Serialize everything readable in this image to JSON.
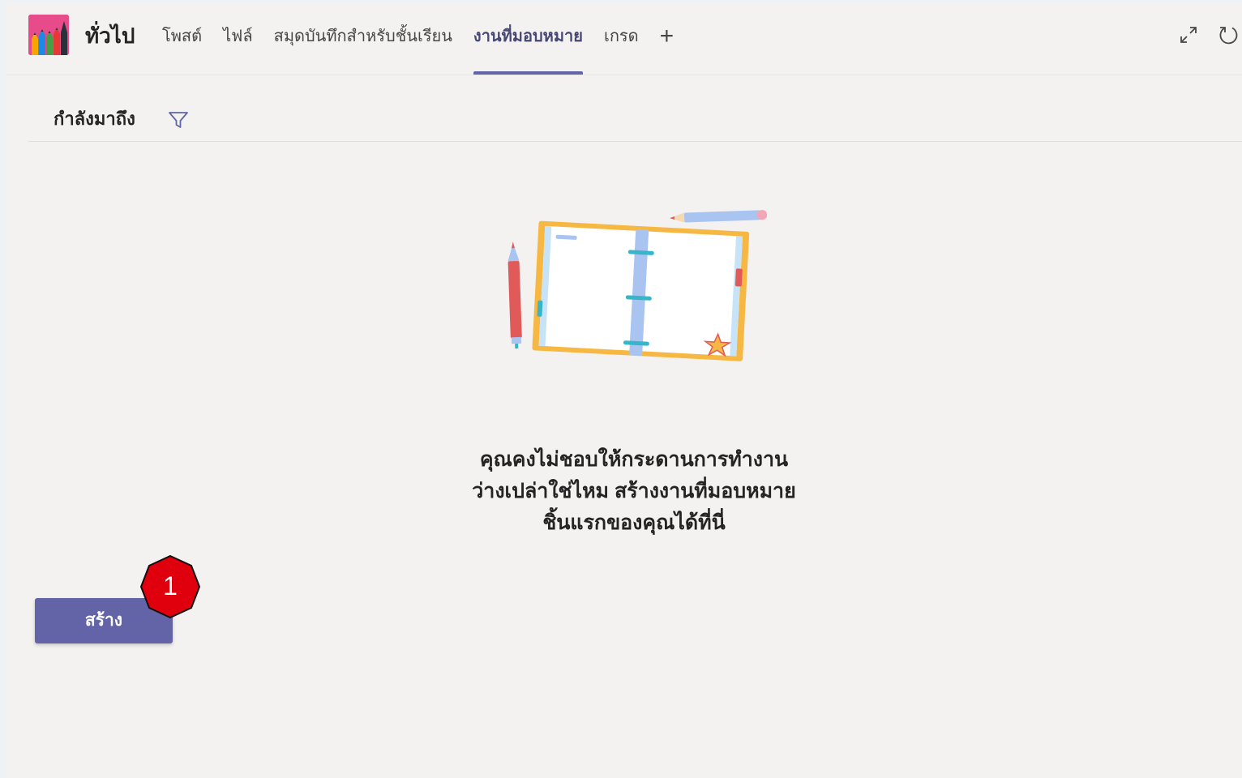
{
  "header": {
    "channel_name": "ทั่วไป",
    "tabs": [
      {
        "label": "โพสต์",
        "active": false
      },
      {
        "label": "ไฟล์",
        "active": false
      },
      {
        "label": "สมุดบันทึกสำหรับชั้นเรียน",
        "active": false
      },
      {
        "label": "งานที่มอบหมาย",
        "active": true
      },
      {
        "label": "เกรด",
        "active": false
      }
    ],
    "add_tab_label": "+",
    "icons": [
      "team-avatar",
      "expand-icon",
      "refresh-icon"
    ]
  },
  "filter": {
    "label": "กำลังมาถึง",
    "icon": "filter-icon"
  },
  "empty_state": {
    "illustration": "notebook-illustration",
    "lines": [
      "คุณคงไม่ชอบให้กระดานการทำงาน",
      "ว่างเปล่าใช่ไหม สร้างงานที่มอบหมาย",
      "ชิ้นแรกของคุณได้ที่นี่"
    ]
  },
  "actions": {
    "create_label": "สร้าง"
  },
  "annotation": {
    "step_number": "1"
  },
  "colors": {
    "accent": "#6264a7",
    "background": "#f3f2f1",
    "badge": "#e0000d"
  }
}
